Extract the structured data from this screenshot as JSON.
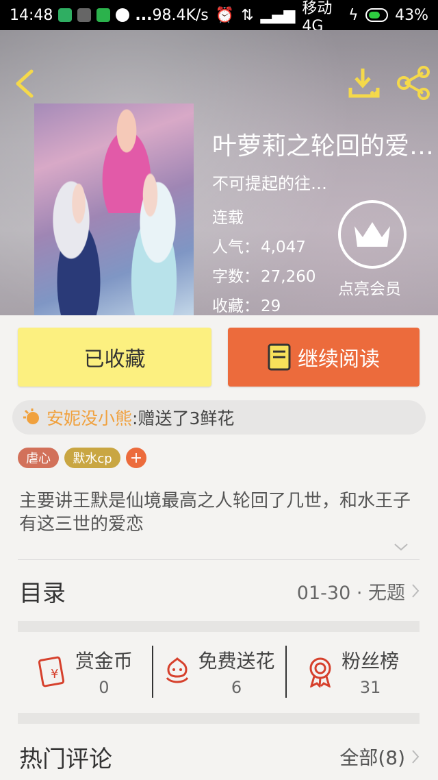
{
  "status_bar": {
    "time": "14:48",
    "dots": "...",
    "speed": "98.4K/s",
    "carrier": "移动 4G",
    "battery": "43%"
  },
  "header": {
    "back_icon": "chevron-left-icon",
    "download_icon": "download-icon",
    "share_icon": "share-icon",
    "book_title": "叶萝莉之轮回的爱…",
    "subtitle": "不可提起的往…",
    "status": "连载",
    "popularity_label": "人气：",
    "popularity": "4,047",
    "words_label": "字数：",
    "words": "27,260",
    "collect_label": "收藏：",
    "collect": "29",
    "vip_icon": "crown-icon",
    "vip_label": "点亮会员"
  },
  "actions": {
    "favorited_label": "已收藏",
    "continue_label": "继续阅读",
    "continue_icon": "book-icon"
  },
  "gift": {
    "icon": "flower-badge-icon",
    "user": "安妮没小熊",
    "text": ":赠送了3鲜花"
  },
  "tags": [
    "虐心",
    "默水cp"
  ],
  "tag_add": "+",
  "intro": "主要讲王默是仙境最高之人轮回了几世，和水王子有这三世的爱恋",
  "catalog": {
    "title": "目录",
    "latest": "01-30 · 无题"
  },
  "stats": [
    {
      "icon": "red-envelope-icon",
      "label": "赏金币",
      "value": "0"
    },
    {
      "icon": "flower-icon",
      "label": "免费送花",
      "value": "6"
    },
    {
      "icon": "medal-icon",
      "label": "粉丝榜",
      "value": "31"
    }
  ],
  "comments": {
    "title": "热门评论",
    "all_label": "全部(8)"
  },
  "colors": {
    "accent_orange": "#ec6b3c",
    "favorite_yellow": "#fcf080",
    "gift_user": "#f0a13e"
  }
}
